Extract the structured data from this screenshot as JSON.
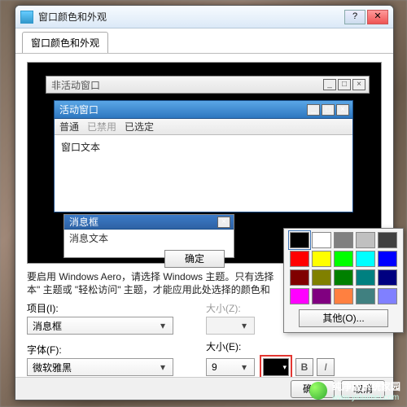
{
  "outer": {
    "title": "窗口颜色和外观",
    "tab": "窗口颜色和外观"
  },
  "preview": {
    "inactive_title": "非活动窗口",
    "active_title": "活动窗口",
    "menu_normal": "普通",
    "menu_disabled": "已禁用",
    "menu_selected": "已选定",
    "window_text": "窗口文本",
    "msgbox_title": "消息框",
    "msgbox_text": "消息文本",
    "ok": "确定"
  },
  "desc_line1": "要启用 Windows Aero，请选择 Windows 主题。只有选择",
  "desc_line2": "本\" 主题或 \"轻松访问\" 主题，才能应用此处选择的颜色和",
  "labels": {
    "item": "项目(I):",
    "size_z": "大小(Z):",
    "font": "字体(F):",
    "size_e": "大小(E):"
  },
  "values": {
    "item": "消息框",
    "size_z": "",
    "font": "微软雅黑",
    "size_e": "9"
  },
  "buttons": {
    "other": "其他(O)...",
    "ok": "确定",
    "cancel": "取消",
    "bold": "B",
    "italic": "I"
  },
  "palette": [
    "#000000",
    "#ffffff",
    "#808080",
    "#c0c0c0",
    "#404040",
    "#ff0000",
    "#ffff00",
    "#00ff00",
    "#00ffff",
    "#0000ff",
    "#800000",
    "#808000",
    "#008000",
    "#008080",
    "#000080",
    "#ff00ff",
    "#800080",
    "#ff8040",
    "#408080",
    "#8080ff"
  ],
  "watermark": {
    "brand": "纯净版系统家园",
    "url": "www.yidaimei.com"
  }
}
